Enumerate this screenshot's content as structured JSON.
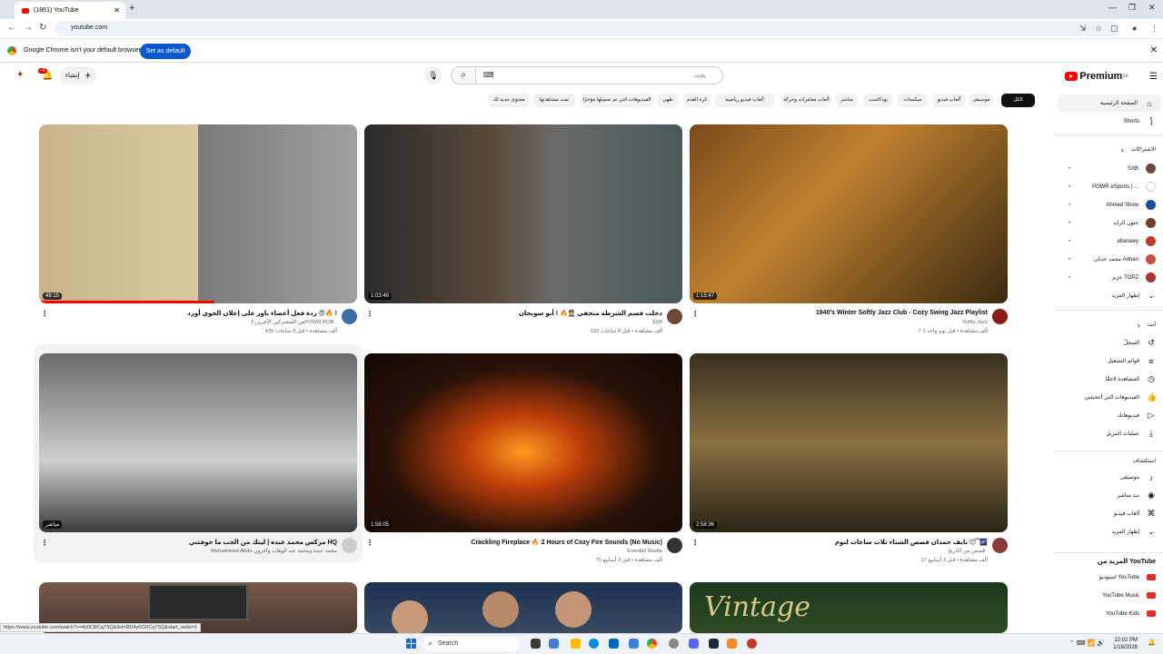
{
  "browser": {
    "tab_title": "(1861) YouTube",
    "address": "youtube.com",
    "infobar_text": "Google Chrome isn't your default browser",
    "infobar_button": "Set as default"
  },
  "masthead": {
    "logo_text": "Premium",
    "logo_region": "SA",
    "search_placeholder": "بحث",
    "create_label": "إنشاء",
    "notif_count": "+9"
  },
  "chips": [
    "الكل",
    "موسيقى",
    "ألعاب فيديو",
    "ميكسات",
    "بودكاست",
    "مباشر",
    "ألعاب مغامرات وحركة",
    "ألعاب فيديو رياضية",
    "كرة القدم",
    "طهي",
    "الفيديوهات التي تم تحميلها مؤخرًا",
    "تمت مشاهدتها",
    "محتوى جديد لك"
  ],
  "sidebar": {
    "home": "الصفحة الرئيسية",
    "shorts": "Shorts",
    "subs_header": "الاشتراكات",
    "subs": [
      {
        "name": "SXB",
        "color": "#6b4a3a"
      },
      {
        "name": "POWR eSports | ...",
        "color": "#ffffff"
      },
      {
        "name": "Ahmed Show",
        "color": "#1a4ea0"
      },
      {
        "name": "جنون الرايد",
        "color": "#7a3b2a"
      },
      {
        "name": "ellanawy",
        "color": "#c0392b"
      },
      {
        "name": "محمد عدنان Adnan",
        "color": "#c94f3d"
      },
      {
        "name": "عزيز TOPZ",
        "color": "#a33"
      }
    ],
    "show_more": "إظهار المزيد",
    "you_header": "أنت",
    "you_items": [
      {
        "label": "السجلّ",
        "icon": "history-icon",
        "glyph": "↺"
      },
      {
        "label": "قوائم التشغيل",
        "icon": "playlist-icon",
        "glyph": "≡"
      },
      {
        "label": "المشاهدة لاحقًا",
        "icon": "clock-icon",
        "glyph": "◷"
      },
      {
        "label": "الفيديوهات التي أعجبتني",
        "icon": "thumb-up-icon",
        "glyph": "👍"
      },
      {
        "label": "فيديوهاتك",
        "icon": "video-icon",
        "glyph": "▷"
      },
      {
        "label": "عمليات التنزيل",
        "icon": "download-icon",
        "glyph": "⤓"
      }
    ],
    "explore_header": "استكشاف",
    "explore_items": [
      {
        "label": "موسيقى",
        "icon": "music-icon",
        "glyph": "♪"
      },
      {
        "label": "بث مباشر",
        "icon": "live-icon",
        "glyph": "◉"
      },
      {
        "label": "ألعاب فيديو",
        "icon": "gaming-icon",
        "glyph": "⌘"
      },
      {
        "label": "إظهار المزيد",
        "icon": "chevron-down-icon",
        "glyph": "⌄"
      }
    ],
    "more_header": "المزيد من YouTube",
    "more_items": [
      {
        "label": "استوديو YouTube",
        "color": "#e52d27"
      },
      {
        "label": "YouTube Music",
        "color": "#e52d27"
      },
      {
        "label": "YouTube Kids",
        "color": "#e52d27"
      }
    ]
  },
  "videos": [
    {
      "title": "ردة فعل أعضاء باور على إعلان الجوي أورد 😍🔥 !",
      "channel": "POWR ROB ·",
      "channel2": "2 من المشتركين الآخرين",
      "stats": "435 ألف مشاهدة • قبل 9 ساعات",
      "duration": "48:15",
      "progress": 0.55
    },
    {
      "title": "دخلت قسم الشرطة متخفي 👮🔥 ! أبو سويحان",
      "channel": "SXB",
      "channel2": "",
      "stats": "122 ألف مشاهدة • قبل 8 ساعات",
      "duration": "1:03:48",
      "progress": 0
    },
    {
      "title": "1940's Winter Softly Jazz Club - Cozy Swing Jazz Playlist",
      "channel": "Softly Jazz",
      "channel2": "",
      "stats": "7.1 ألف مشاهدة • قبل يوم واحد",
      "duration": "1:15:47",
      "progress": 0
    },
    {
      "title": "مزكس محمد عبده | ليتك من الحب ما خوفتني HQ",
      "channel": "Mohammed Abdo محمد عبده ومحمد عبد الوهاب وآخرون",
      "channel2": "",
      "stats": "",
      "duration": "مباشر",
      "progress": 0
    },
    {
      "title": "Crackling Fireplace 🔥 2 Hours of Cozy Fire Sounds (No Music)",
      "channel": "Evenfall Studio",
      "channel2": "",
      "stats": "70 ألف مشاهدة • قبل 3 أسابيع",
      "duration": "1:58:05",
      "progress": 0
    },
    {
      "title": "نايف حمدان قصص الشتاء ثلاث ساعات لنوم 😴🌌",
      "channel": "قصص من التاريخ",
      "channel2": "",
      "stats": "17 ألف مشاهدة • قبل 3 أسابيع",
      "duration": "2:58:36",
      "progress": 0
    }
  ],
  "statuslink": "https://www.youtube.com/watch?v=4y0CRCq7SQ&list=RD4y0CRCq7SQ&start_radio=1",
  "taskbar": {
    "search": "Search",
    "time": "10:02 PM",
    "date": "1/18/2026"
  }
}
